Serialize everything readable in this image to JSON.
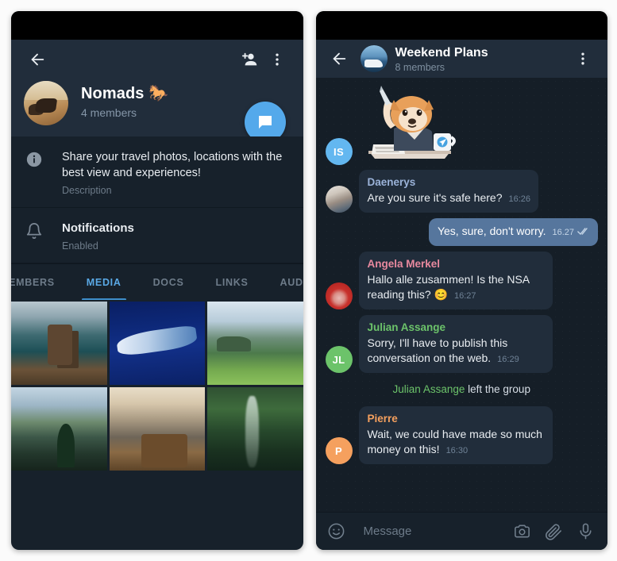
{
  "app": "Telegram Android - Group Profile and Chat",
  "left_panel": {
    "name": "group-profile-screen",
    "topbar": {
      "back_icon": "back-arrow-icon",
      "add_member_icon": "add-person-icon",
      "more_icon": "more-vertical-icon"
    },
    "profile": {
      "title": "Nomads 🐎",
      "title_text": "Nomads",
      "emoji": "🐎",
      "members": "4 members",
      "avatar_name": "group-avatar",
      "fab_icon": "message-bubble-icon"
    },
    "rows": [
      {
        "icon": "info-icon",
        "main": "Share your travel photos, locations with the best view and experiences!",
        "sub": "Description"
      },
      {
        "icon": "bell-icon",
        "main": "Notifications",
        "sub": "Enabled"
      }
    ],
    "tabs": [
      {
        "label": "MEMBERS",
        "active": false,
        "clipped": true
      },
      {
        "label": "MEDIA",
        "active": true,
        "clipped": false
      },
      {
        "label": "DOCS",
        "active": false,
        "clipped": false
      },
      {
        "label": "LINKS",
        "active": false,
        "clipped": false
      },
      {
        "label": "AUDIO",
        "active": false,
        "clipped": false
      }
    ],
    "media": [
      {
        "alt": "crater-lake-island"
      },
      {
        "alt": "blue-night-river-ice"
      },
      {
        "alt": "green-alpine-meadow-cabin"
      },
      {
        "alt": "mountain-lake-pines"
      },
      {
        "alt": "mountain-valley-stone-house"
      },
      {
        "alt": "forest-waterfall"
      }
    ]
  },
  "right_panel": {
    "name": "chat-screen",
    "topbar": {
      "back_icon": "back-arrow-icon",
      "title": "Weekend Plans",
      "subtitle": "8 members",
      "avatar_name": "chat-avatar",
      "more_icon": "more-vertical-icon"
    },
    "messages": [
      {
        "type": "sticker",
        "avatar": {
          "initials": "IS",
          "color": "#63b7f0"
        },
        "sticker_name": "shiba-dog-sticker"
      },
      {
        "type": "in",
        "avatar": {
          "initials": "",
          "style": "photo-daen"
        },
        "sender": "Daenerys",
        "sender_color": "#9bb3d9",
        "text": "Are you sure it's safe here?",
        "time": "16:26"
      },
      {
        "type": "out",
        "text": "Yes, sure, don't worry.",
        "time": "16.27",
        "status": "double-check-icon"
      },
      {
        "type": "in",
        "avatar": {
          "initials": "",
          "style": "photo-merkel"
        },
        "sender": "Angela Merkel",
        "sender_color": "#e8899f",
        "text": "Hallo alle zusammen! Is the NSA reading this? 😊",
        "time": "16:27"
      },
      {
        "type": "in",
        "avatar": {
          "initials": "JL",
          "color": "#6cc36a"
        },
        "sender": "Julian Assange",
        "sender_color": "#6cc36a",
        "text": "Sorry, I'll have to publish this conversation on the web.",
        "time": "16:29"
      },
      {
        "type": "service",
        "who": "Julian Assange",
        "action": "left the group"
      },
      {
        "type": "in",
        "avatar": {
          "initials": "P",
          "color": "#f5a05e"
        },
        "sender": "Pierre",
        "sender_color": "#f5a05e",
        "text": "Wait, we could have made so much money on this!",
        "time": "16:30"
      }
    ],
    "input": {
      "emoji_icon": "smiley-icon",
      "placeholder": "Message",
      "camera_icon": "camera-icon",
      "attach_icon": "paperclip-icon",
      "mic_icon": "microphone-icon"
    }
  },
  "colors": {
    "accent": "#54a9eb",
    "header_bg": "#212d3b",
    "panel_bg": "#17212b",
    "chat_bg": "#151e27",
    "bubble_in": "#212d3b",
    "bubble_out": "#56769d",
    "tab_active": "#5aa9e6"
  }
}
